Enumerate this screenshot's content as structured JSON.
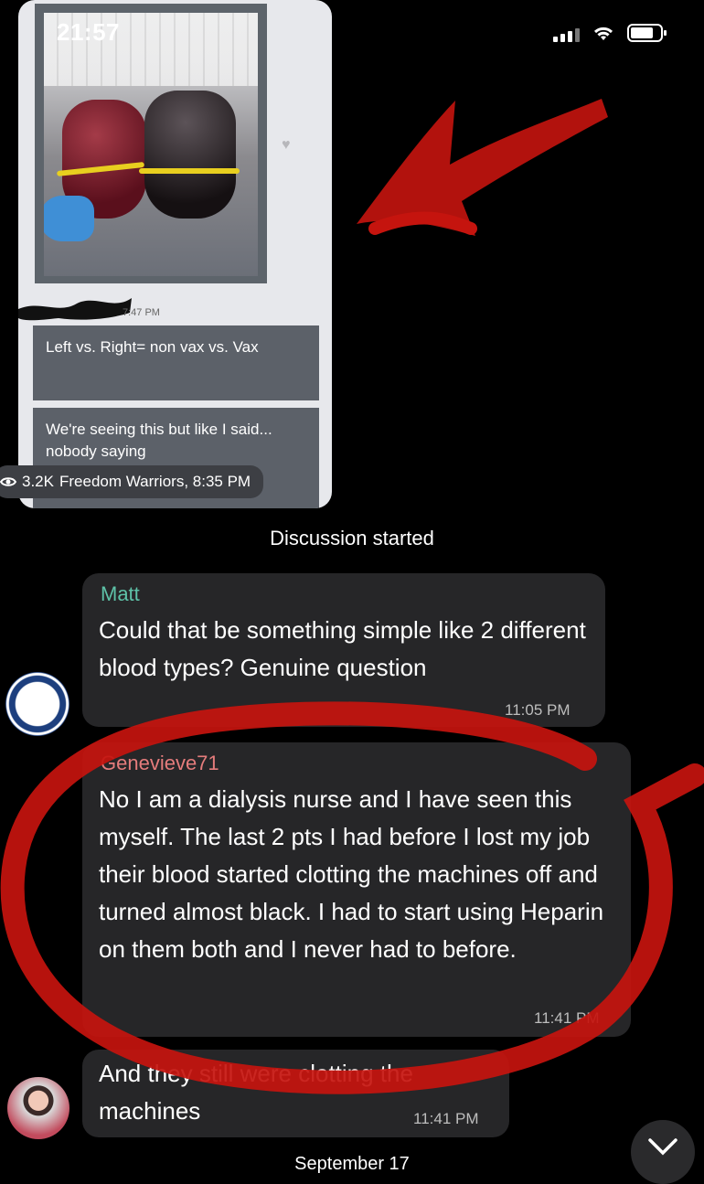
{
  "status_bar": {
    "time": "21:57"
  },
  "shared_screenshot": {
    "message_time": "7:47 PM",
    "bubble_1": "Left vs. Right= non vax vs. Vax",
    "bubble_2": "We're seeing this but like I said... nobody saying",
    "views": "3.2K",
    "channel_meta": "Freedom Warriors, 8:35 PM"
  },
  "system_message": "Discussion started",
  "messages": [
    {
      "author": "Matt",
      "author_color": "#5ec2a8",
      "text": "Could that be something simple like 2 different blood types? Genuine question",
      "time": "11:05 PM"
    },
    {
      "author": "Genevieve71",
      "author_color": "#e57c7c",
      "text": "No I am a dialysis nurse and I have seen this myself. The last 2 pts I had before I lost my job their blood started clotting the machines off and turned almost black. I had to start using Heparin on them both and I never had to before.",
      "time": "11:41 PM"
    },
    {
      "author": "",
      "text": "And they still were clotting the machines",
      "time": "11:41 PM"
    }
  ],
  "date_divider": "September 17",
  "annotation_color": "#c5140e"
}
